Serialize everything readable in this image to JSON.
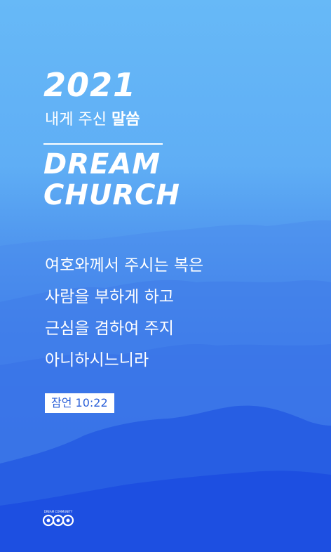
{
  "poster": {
    "year": "2021",
    "subtitle_light": "내게 주신",
    "subtitle_bold": "말씀",
    "brand_line1": "DREAM",
    "brand_line2": "CHURCH",
    "verse_lines": [
      "여호와께서 주시는 복은",
      "사람을 부하게 하고",
      "근심을 겸하여 주지",
      "아니하시느니라"
    ],
    "reference": "잠언 10:22",
    "logo_text": "DREAM COMMUNITY",
    "logo_icon": "dream-community-logo-icon"
  },
  "colors": {
    "sky_top": "#67b9f7",
    "sky_bottom": "#1e4fe0",
    "text": "#ffffff",
    "reference_text": "#2a5fd8"
  }
}
